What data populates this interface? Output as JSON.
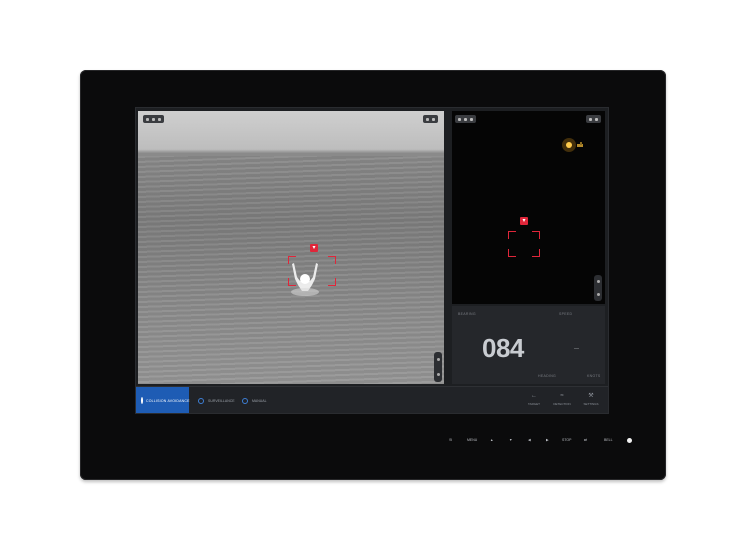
{
  "modes": {
    "active": "COLLISION AVOIDANCE",
    "surveillance": "SURVEILLANCE",
    "manual": "MANUAL"
  },
  "data_panel": {
    "bearing_label": "BEARING",
    "speed_label": "SPEED",
    "bearing_value": "084",
    "small_value": "—",
    "unit_left": "HEADING",
    "unit_right": "KNOTS"
  },
  "tools": [
    {
      "label": "TARGET",
      "icon": "arrow-left-icon"
    },
    {
      "label": "DETECTION",
      "icon": "signal-icon"
    },
    {
      "label": "SETTINGS",
      "icon": "wrench-icon"
    }
  ],
  "hardware_buttons": [
    "!5",
    "MENU",
    "▲",
    "▼",
    "◀",
    "▶",
    "STOP",
    "⇄",
    "BELL"
  ],
  "colors": {
    "accent": "#1e5cb4",
    "alert": "#e0263a"
  }
}
